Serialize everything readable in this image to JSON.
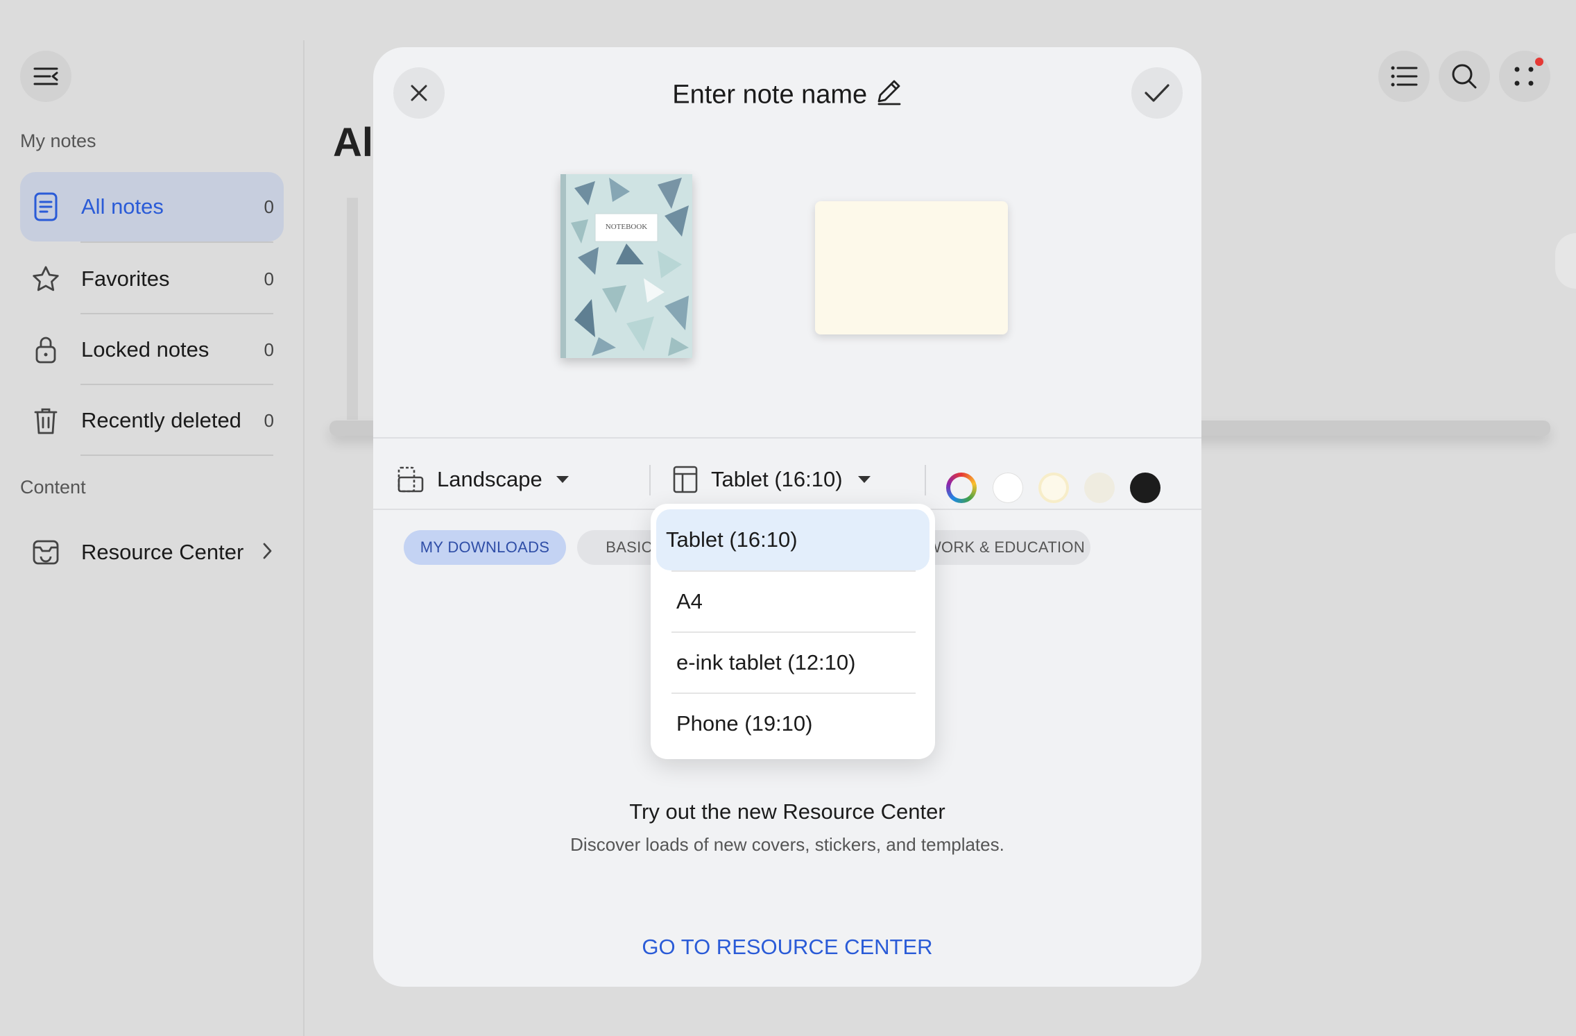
{
  "sidebar": {
    "sections": {
      "my_notes": "My notes",
      "content": "Content"
    },
    "items": [
      {
        "label": "All notes",
        "count": "0",
        "icon": "note-icon"
      },
      {
        "label": "Favorites",
        "count": "0",
        "icon": "star-icon"
      },
      {
        "label": "Locked notes",
        "count": "0",
        "icon": "lock-icon"
      },
      {
        "label": "Recently deleted",
        "count": "0",
        "icon": "trash-icon"
      }
    ],
    "resource_center": {
      "label": "Resource Center",
      "icon": "resource-center-icon"
    }
  },
  "main": {
    "title_partial": "Al"
  },
  "dialog": {
    "title": "Enter note name",
    "cover_label": "NOTEBOOK",
    "orientation": "Landscape",
    "paper_size": "Tablet (16:10)",
    "colors": [
      "spectrum",
      "#ffffff",
      "#fdf9ea",
      "#efece0",
      "#1c1c1c"
    ],
    "tabs": [
      {
        "label": "MY DOWNLOADS",
        "active": true
      },
      {
        "label": "BASIC",
        "active": false
      },
      {
        "label": "WORK & EDUCATION",
        "active": false
      }
    ],
    "dropdown": {
      "options": [
        "Tablet (16:10)",
        "A4",
        "e-ink tablet (12:10)",
        "Phone (19:10)"
      ],
      "selected": "Tablet (16:10)"
    },
    "promo": {
      "title": "Try out the new Resource Center",
      "subtitle": "Discover loads of new covers, stickers, and templates.",
      "link": "GO TO RESOURCE CENTER"
    }
  },
  "accent_color": "#2a5bd7"
}
